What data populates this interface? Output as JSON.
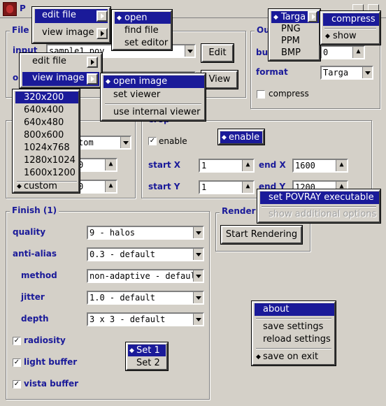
{
  "window": {
    "title": "P"
  },
  "colors": {
    "face": "#d4d0c8",
    "accent": "#1a1a99",
    "highlight_text": "#ffffff"
  },
  "files": {
    "label": "File",
    "input_label": "input",
    "input_value": "sample1.pov",
    "edit_button": "Edit",
    "output_label": "ou",
    "view_button": "View"
  },
  "output": {
    "label": "Ou",
    "buffer_label": "buf",
    "buffer_value": "0",
    "format_label": "format",
    "format_value": "Targa",
    "compress_label": "compress"
  },
  "resolution": {
    "combo_value": "tom",
    "spin1_value": "0",
    "spin2_value": "0"
  },
  "crop": {
    "label": "Crop",
    "enable_label": "enable",
    "start_x_label": "start X",
    "start_x": "1",
    "end_x_label": "end X",
    "end_x": "1600",
    "start_y_label": "start Y",
    "start_y": "1",
    "end_y_label": "end Y",
    "end_y": "1200"
  },
  "finish": {
    "label": "Finish (1)",
    "quality_label": "quality",
    "quality_value": "9 - halos",
    "antialias_label": "anti-alias",
    "antialias_value": "0.3 - default",
    "method_label": "method",
    "method_value": "non-adaptive - default",
    "jitter_label": "jitter",
    "jitter_value": "1.0 - default",
    "depth_label": "depth",
    "depth_value": "3 x 3 - default",
    "radiosity_label": "radiosity",
    "light_buffer_label": "light buffer",
    "vista_buffer_label": "vista buffer"
  },
  "render": {
    "label": "Render",
    "start_button": "Start Rendering"
  },
  "menus": {
    "top_file_menu": {
      "edit_file": "edit file",
      "view_image": "view image"
    },
    "edit_file_submenu": {
      "open": "open",
      "find_file": "find file",
      "set_editor": "set editor"
    },
    "file_menu2": {
      "edit_file": "edit file",
      "view_image": "view image"
    },
    "view_image_submenu": {
      "open_image": "open image",
      "set_viewer": "set viewer",
      "use_internal": "use internal viewer"
    },
    "resolutions": [
      "320x200",
      "640x400",
      "640x480",
      "800x600",
      "1024x768",
      "1280x1024",
      "1600x1200"
    ],
    "custom": "custom",
    "formats": [
      "Targa",
      "PNG",
      "PPM",
      "BMP"
    ],
    "format_submenu": {
      "compress": "compress",
      "show": "show"
    },
    "crop_enable_menu": {
      "enable": "enable"
    },
    "povray_menu": {
      "set_exec": "set POVRAY executable",
      "show_additional": "show additional options"
    },
    "sets": [
      "Set 1",
      "Set 2"
    ],
    "settings_menu": {
      "about": "about",
      "save": "save settings",
      "reload": "reload settings",
      "save_on_exit": "save on exit"
    }
  }
}
